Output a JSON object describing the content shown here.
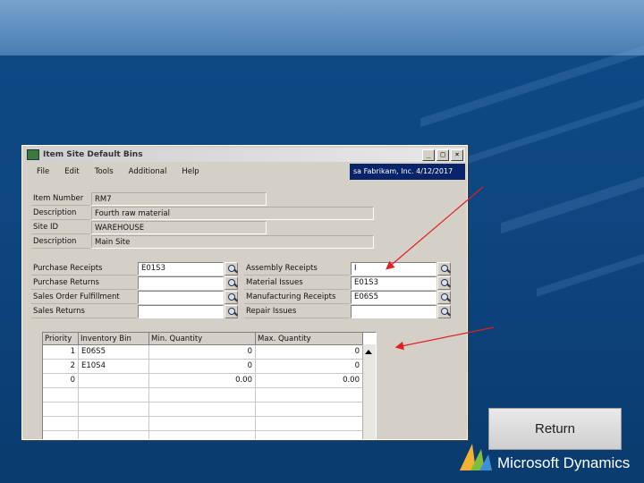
{
  "window": {
    "title": "Item Site Default Bins",
    "buttons": {
      "minimize": "_",
      "maximize": "□",
      "close": "×"
    },
    "menu": [
      "File",
      "Edit",
      "Tools",
      "Additional",
      "Help"
    ],
    "company_info": "sa  Fabrikam, Inc.  4/12/2017"
  },
  "header": {
    "item_number_label": "Item Number",
    "item_number": "RM7",
    "description_label": "Description",
    "description": "Fourth raw material",
    "site_id_label": "Site ID",
    "site_id": "WAREHOUSE",
    "site_description_label": "Description",
    "site_description": "Main Site"
  },
  "bins": {
    "purchase_receipts_label": "Purchase Receipts",
    "purchase_receipts": "E01S3",
    "purchase_returns_label": "Purchase Returns",
    "purchase_returns": "",
    "sales_order_fulfillment_label": "Sales Order Fulfillment",
    "sales_order_fulfillment": "",
    "sales_returns_label": "Sales Returns",
    "sales_returns": "",
    "assembly_receipts_label": "Assembly Receipts",
    "assembly_receipts": "I",
    "material_issues_label": "Material Issues",
    "material_issues": "E01S3",
    "manufacturing_receipts_label": "Manufacturing Receipts",
    "manufacturing_receipts": "E06S5",
    "repair_issues_label": "Repair Issues",
    "repair_issues": ""
  },
  "grid": {
    "columns": [
      "Priority",
      "Inventory Bin",
      "Min. Quantity",
      "Max. Quantity"
    ],
    "rows": [
      {
        "priority": "1",
        "bin": "E06S5",
        "min": "0",
        "max": "0"
      },
      {
        "priority": "2",
        "bin": "E10S4",
        "min": "0",
        "max": "0"
      },
      {
        "priority": "0",
        "bin": "",
        "min": "0.00",
        "max": "0.00"
      }
    ]
  },
  "return_button": "Return",
  "brand": "Microsoft Dynamics",
  "colors": {
    "background": "#0f4a86",
    "arrow": "#e02020",
    "company_bar": "#0a246a"
  }
}
